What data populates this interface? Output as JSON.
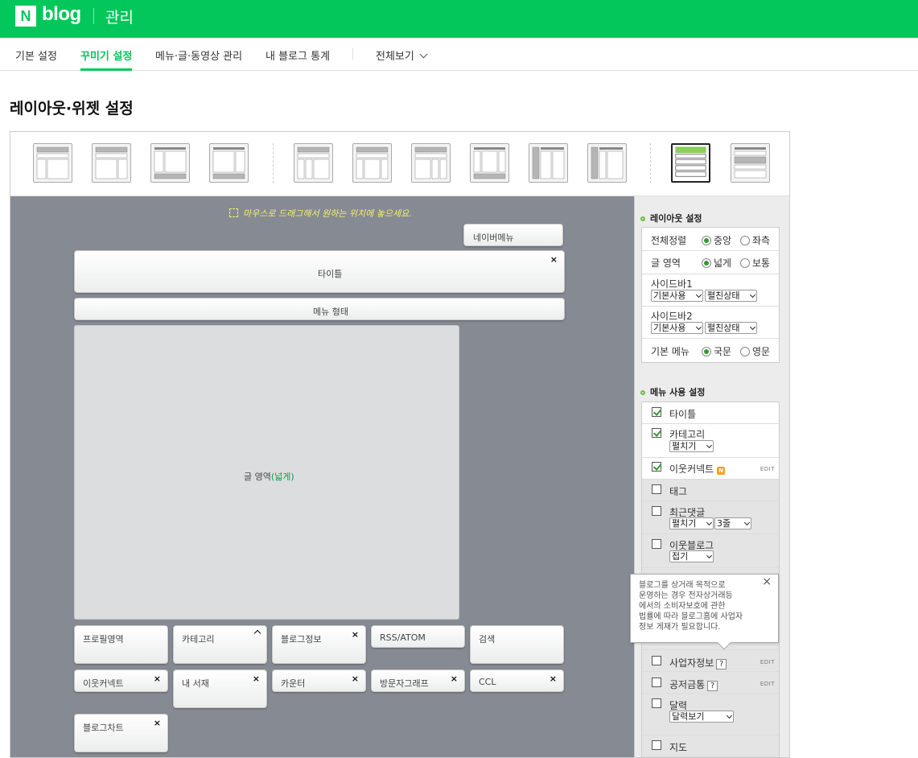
{
  "header": {
    "logo_n": "N",
    "logo_text": "blog",
    "title": "관리"
  },
  "nav": {
    "items": [
      "기본 설정",
      "꾸미기 설정",
      "메뉴·글·동영상 관리",
      "내 블로그 통계"
    ],
    "view_all": "전체보기",
    "active_index": 1
  },
  "page_title": "레이아웃·위젯 설정",
  "canvas": {
    "hint": "마우스로 드래그해서 원하는 위치에 놓으세요.",
    "navermenu": "네이버메뉴",
    "title_widget": "타이틀",
    "menu_widget": "메뉴 형태",
    "content_label": "글 영역",
    "content_suffix": "(넓게)",
    "close_symbol": "×",
    "widgets": {
      "profile": "프로필영역",
      "category": "카테고리",
      "bloginfo": "블로그정보",
      "rss": "RSS/ATOM",
      "search": "검색",
      "neighbor": "이웃커넥트",
      "library": "내 서재",
      "counter": "카운터",
      "visitgraph": "방문자그래프",
      "ccl": "CCL",
      "blogchart": "블로그차트"
    }
  },
  "layout_settings": {
    "title": "레이아웃 설정",
    "align": {
      "label": "전체정렬",
      "options": [
        "중앙",
        "좌측"
      ],
      "selected": "중앙"
    },
    "area": {
      "label": "글 영역",
      "options": [
        "넓게",
        "보통"
      ],
      "selected": "넓게"
    },
    "sidebar1": {
      "label": "사이드바1",
      "select1": "기본사용",
      "select2": "펼친상태"
    },
    "sidebar2": {
      "label": "사이드바2",
      "select1": "기본사용",
      "select2": "펼친상태"
    },
    "menu_lang": {
      "label": "기본 메뉴",
      "options": [
        "국문",
        "영문"
      ],
      "selected": "국문"
    }
  },
  "menu_settings": {
    "title": "메뉴 사용 설정",
    "items": {
      "title": {
        "label": "타이틀",
        "checked": true
      },
      "category": {
        "label": "카테고리",
        "checked": true,
        "select": "펼치기"
      },
      "neighbor": {
        "label": "이웃커넥트",
        "checked": true,
        "badge": "N",
        "edit": "EDIT"
      },
      "tag": {
        "label": "태그",
        "checked": false
      },
      "recent_comments": {
        "label": "최근댓글",
        "checked": false,
        "select1": "펼치기",
        "select2": "3줄"
      },
      "neighbor_blog": {
        "label": "이웃블로그",
        "checked": false,
        "select": "접기"
      },
      "business": {
        "label": "사업자정보",
        "checked": false,
        "help": "?",
        "edit": "EDIT"
      },
      "donation": {
        "label": "공저금통",
        "checked": false,
        "help": "?",
        "edit": "EDIT"
      },
      "calendar": {
        "label": "달력",
        "checked": false,
        "select": "달력보기"
      },
      "map": {
        "label": "지도",
        "checked": false
      }
    }
  },
  "tooltip": {
    "lines": [
      "블로그를 상거래 목적으로",
      "운영하는 경우 전자상거래등",
      "에서의 소비자보호에 관한",
      "법률에 따라 블로그홈에 사업자",
      "정보 게재가 필요합니다."
    ],
    "close": "×"
  },
  "colors": {
    "brand": "#03c75a",
    "canvas": "#868a93",
    "hint": "#f5f06a"
  }
}
